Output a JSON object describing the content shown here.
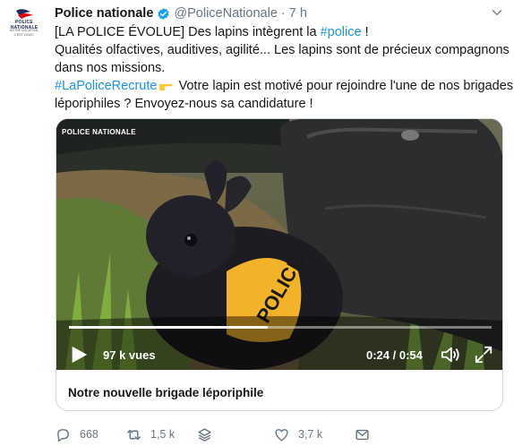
{
  "tweet": {
    "display_name": "Police nationale",
    "handle": "@PoliceNationale",
    "separator": "·",
    "time": "7 h",
    "avatar_logo_text": "POLICE NATIONALE",
    "avatar_logo_sub": "NOTRE VOCATION, C'EST VOUS !",
    "text_lines": {
      "l1_prefix": "[LA POLICE ÉVOLUE] Des lapins intègrent la ",
      "l1_hashtag": "#police",
      "l1_suffix": " !",
      "l2": "Qualités olfactives, auditives, agilité... Les lapins sont de précieux compagnons",
      "l3": "dans nos missions.",
      "l4_hashtag": "#LaPoliceRecrute",
      "l4_suffix": " Votre lapin est motivé pour rejoindre l'une de nos brigades",
      "l5": "léporiphiles ? Envoyez-nous sa candidature !"
    }
  },
  "video": {
    "watermark": "POLICE NATIONALE",
    "badge_text": "POLICE",
    "views": "97 k vues",
    "time_display": "0:24 / 0:54",
    "progress_fraction": 0.47
  },
  "card": {
    "title": "Notre nouvelle brigade léporiphile"
  },
  "actions": {
    "reply_count": "668",
    "retweet_count": "1,5 k",
    "like_count": "3,7 k"
  },
  "colors": {
    "link": "#1b95e0",
    "secondary": "#657786",
    "verified": "#1da1f2"
  }
}
